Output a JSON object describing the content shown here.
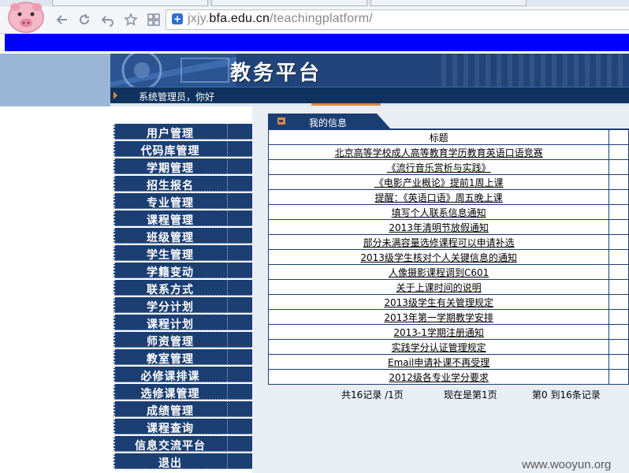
{
  "browser": {
    "url_prefix": "jxjy.",
    "url_domain": "bfa.edu.cn",
    "url_path": "/teachingplatform/"
  },
  "header": {
    "title": "教务平台",
    "welcome": "系统管理员，你好"
  },
  "sidebar": {
    "items": [
      "用户管理",
      "代码库管理",
      "学期管理",
      "招生报名",
      "专业管理",
      "课程管理",
      "班级管理",
      "学生管理",
      "学籍变动",
      "联系方式",
      "学分计划",
      "课程计划",
      "师资管理",
      "教室管理",
      "必修课排课",
      "选修课管理",
      "成绩管理",
      "课程查询",
      "信息交流平台",
      "退出"
    ]
  },
  "panel": {
    "tab_label": "我的信息",
    "column_title": "标题",
    "rows": [
      "北京高等学校成人高等教育学历教育英语口语竞赛",
      "《流行音乐赏析与实践》",
      "《电影产业概论》提前1周上课",
      "提醒：《英语口语》周五晚上课",
      "填写个人联系信息通知",
      "2013年清明节放假通知",
      "部分未满容量选修课程可以申请补选",
      "2013级学生核对个人关键信息的通知",
      "人像摄影课程调到C601",
      "关于上课时间的说明",
      "2013级学生有关管理规定",
      "2013年第一学期教学安排",
      "2013-1学期注册通知",
      "实践学分认证管理规定",
      "Email申请补课不再受理",
      "2012级各专业学分要求"
    ],
    "pager": {
      "total": "共16记录 /1页",
      "current": "现在是第1页",
      "range": "第0 到16条记录"
    }
  },
  "watermark": "www.wooyun.org"
}
